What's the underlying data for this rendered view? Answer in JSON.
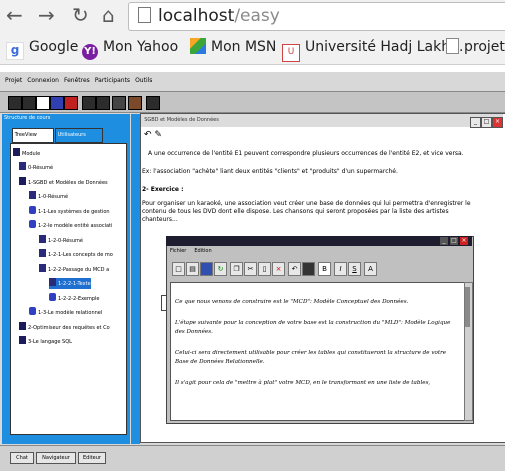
{
  "browser": {
    "url_host": "localhost",
    "url_path": "/easy",
    "bookmarks": [
      {
        "label": "Google",
        "icon": "google-icon"
      },
      {
        "label": "Mon Yahoo",
        "icon": "yahoo-icon"
      },
      {
        "label": "Mon MSN",
        "icon": "msn-icon"
      },
      {
        "label": "Université Hadj Lakh...",
        "icon": "university-icon"
      },
      {
        "label": "projets",
        "icon": "page-icon"
      }
    ]
  },
  "app": {
    "menu": [
      "Projet",
      "Connexion",
      "Fenêtres",
      "Participants",
      "Outils"
    ],
    "left_panel": {
      "title": "Structure de cours",
      "tabs": [
        "TreeView",
        "Utilisateurs"
      ],
      "tree": [
        {
          "label": "Module",
          "type": "p"
        },
        {
          "label": "0-Résumé",
          "type": "n"
        },
        {
          "label": "1-SGBD et Modèles de Données",
          "type": "p"
        },
        {
          "label": "1-0-Résumé",
          "type": "n"
        },
        {
          "label": "1-1-Les systèmes de gestion",
          "type": "c"
        },
        {
          "label": "1-2-le modèle entité associati",
          "type": "c"
        },
        {
          "label": "1-2-0-Résumé",
          "type": "n"
        },
        {
          "label": "1-2-1-Les concepts de mo",
          "type": "n"
        },
        {
          "label": "1-2-2-Passage du MCD a",
          "type": "n"
        },
        {
          "label": "1-2-2-1-Texte",
          "type": "n"
        },
        {
          "label": "1-2-2-2-Exemple",
          "type": "c"
        },
        {
          "label": "1-3-Le modèle relationnel",
          "type": "c"
        },
        {
          "label": "2-Optimiseur des requêtes et Co",
          "type": "p"
        },
        {
          "label": "3-Le langage SQL",
          "type": "p"
        }
      ]
    },
    "doc_window": {
      "title": "SGBD et Modèles de Données",
      "para1": "A une occurrence de l'entité E1 peuvent correspondre plusieurs occurrences de l'entité E2, et vice versa.",
      "para2": "Ex: l'association \"achète\" liant deux entités \"clients\" et \"produits\" d'un supermarché.",
      "exercise_heading": "2- Exercice :",
      "para3": "Pour organiser un karaoké, une association veut créer une base de données qui lui permettra d'enregistrer le contenu de tous les DVD dont elle dispose. Les chansons qui seront proposées par la liste des artistes chanteurs..."
    },
    "editor_window": {
      "menu": [
        "Fichier",
        "Edition"
      ],
      "tools": [
        "B",
        "I",
        "S",
        "A"
      ],
      "paragraphs": [
        "Ce que nous venons de construire est le \"MCD\": Modèle Conceptuel des Données.",
        "L'étape suivante pour la conception de votre base est la construction du \"MLD\": Modèle Logique des Données.",
        "Celui-ci sera directement utilisable pour créer les tables qui constitueront la structure de votre Base de Données Relationnelle.",
        "Il s'agit pour cela de \"mettre à plat\" votre MCD, en le transformant en une liste de tables,"
      ]
    },
    "bottom_buttons": [
      "Chat",
      "Navigateur",
      "Editeur"
    ]
  }
}
